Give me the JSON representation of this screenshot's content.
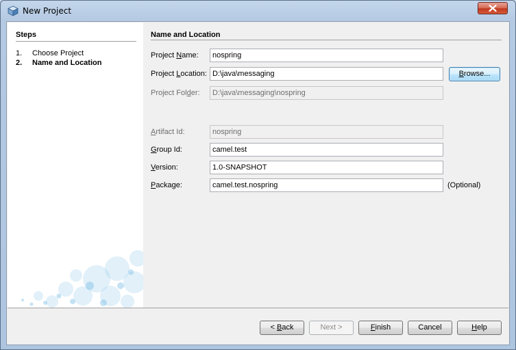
{
  "window": {
    "title": "New Project",
    "icon": "netbeans-cube-icon"
  },
  "steps": {
    "title": "Steps",
    "items": [
      {
        "num": "1.",
        "label": "Choose Project",
        "current": false
      },
      {
        "num": "2.",
        "label": "Name and Location",
        "current": true
      }
    ]
  },
  "panel": {
    "title": "Name and Location",
    "project_name": {
      "label": "Project Name:",
      "value": "nospring"
    },
    "project_location": {
      "label": "Project Location:",
      "value": "D:\\java\\messaging"
    },
    "browse_label": "Browse...",
    "project_folder": {
      "label": "Project Folder:",
      "value": "D:\\java\\messaging\\nospring"
    },
    "artifact_id": {
      "label": "Artifact Id:",
      "value": "nospring"
    },
    "group_id": {
      "label": "Group Id:",
      "value": "camel.test"
    },
    "version": {
      "label": "Version:",
      "value": "1.0-SNAPSHOT"
    },
    "package": {
      "label": "Package:",
      "value": "camel.test.nospring",
      "hint": "(Optional)"
    }
  },
  "buttons": {
    "back": "< Back",
    "next": "Next >",
    "finish": "Finish",
    "cancel": "Cancel",
    "help": "Help"
  },
  "colors": {
    "title_gradient_top": "#c3d6ec",
    "close_button": "#c0391f",
    "dialog_background": "#f0f0f0",
    "focus_border": "#3c7fb1",
    "bubbles": "#a9d4ef"
  }
}
